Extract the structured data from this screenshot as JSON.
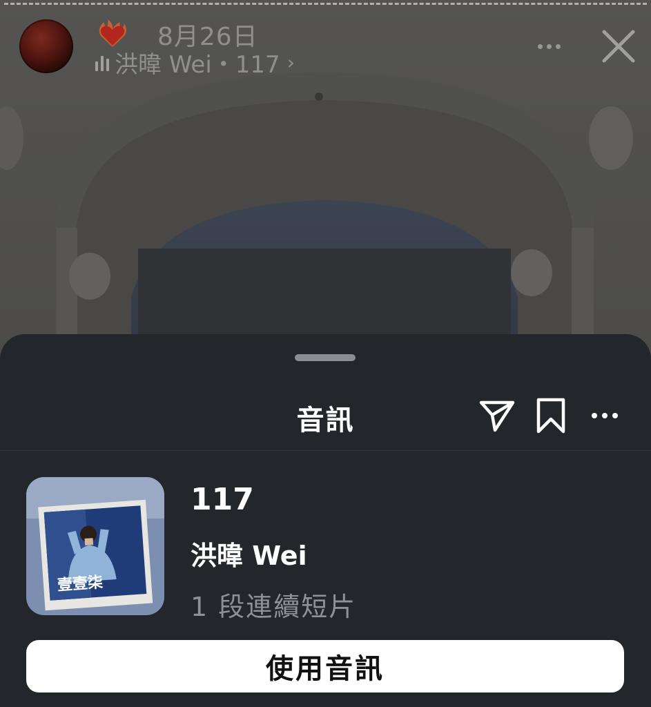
{
  "story": {
    "date": "8月26日",
    "music_text": "洪暐 Wei・117",
    "music_chevron": "›",
    "icons": {
      "avatar": "profile-avatar",
      "emoji": "heart-on-fire-emoji",
      "music": "audio-bars-icon",
      "more": "more-horizontal-icon",
      "close": "close-icon"
    }
  },
  "sheet": {
    "title": "音訊",
    "actions": [
      "send-icon",
      "bookmark-icon",
      "more-horizontal-icon"
    ],
    "track": {
      "title": "117",
      "artist": "洪暐 Wei",
      "meta": "1 段連續短片",
      "cover_art_text": "壹壹柒"
    },
    "use_button_label": "使用音訊"
  },
  "colors": {
    "sheet_background": "#23262b",
    "button_background": "#ffffff",
    "secondary_text": "#8e9197"
  }
}
